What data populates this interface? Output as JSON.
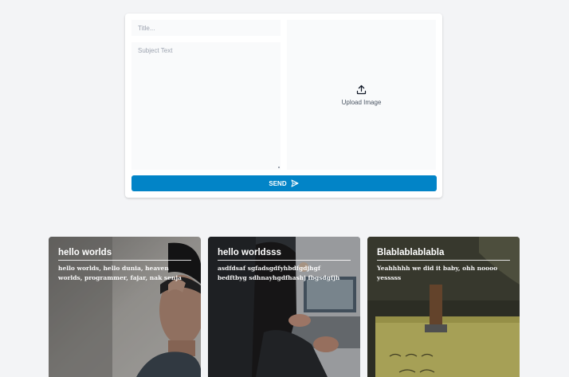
{
  "form": {
    "title_placeholder": "Title...",
    "title_value": "",
    "subject_placeholder": "Subject Text",
    "subject_value": "",
    "upload_label": "Upload Image",
    "upload_icon": "upload-icon",
    "send_label": "SEND",
    "send_icon": "send-icon",
    "accent_color": "#0284c7"
  },
  "cards": [
    {
      "title": "hello worlds",
      "description": "hello worlds, hello dunia, heaven worlds, programmer, fajar, nak senja"
    },
    {
      "title": "hello worldsss",
      "description": "asdfdsaf sgfadsgdfyhbdfgdjhgf bedftbyg sdhnayhgdfhashj fbgsdgfjh"
    },
    {
      "title": "Blablablablabla",
      "description": "Yeahhhhh we did it baby, ohh noooo yesssss"
    }
  ]
}
